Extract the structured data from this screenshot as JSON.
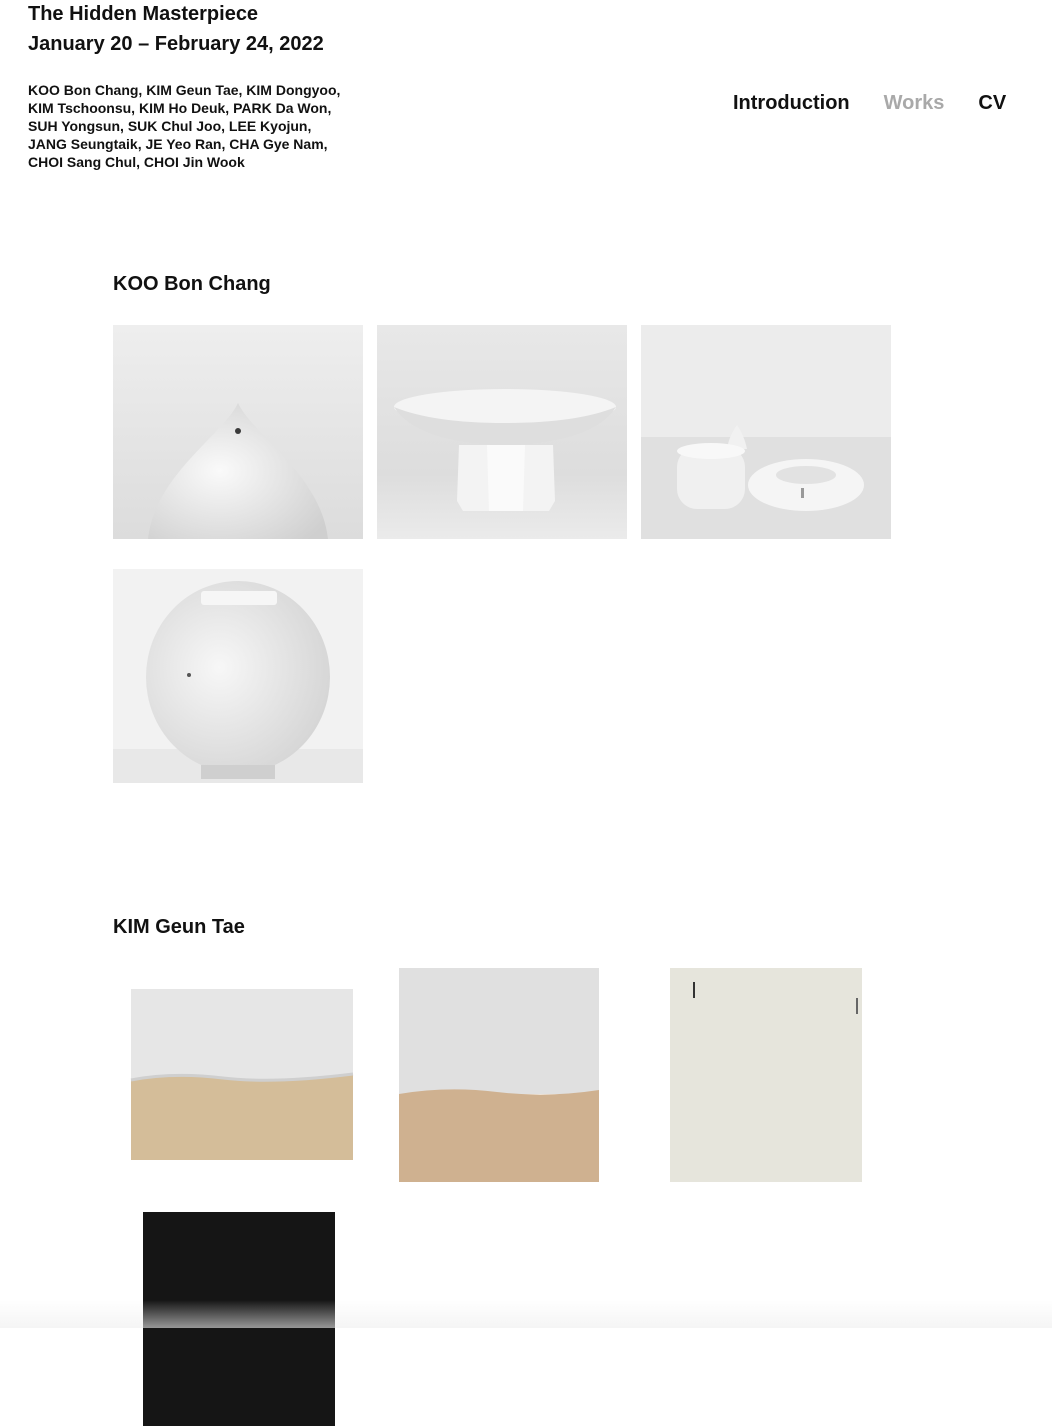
{
  "header": {
    "title": "The Hidden Masterpiece",
    "dates": "January 20 – February 24, 2022",
    "artists": "KOO Bon Chang, KIM Geun Tae, KIM Dongyoo, KIM Tschoonsu, KIM Ho Deuk, PARK Da Won, SUH Yongsun, SUK Chul Joo, LEE Kyojun, JANG Seungtaik, JE Yeo Ran, CHA Gye Nam, CHOI Sang Chul, CHOI Jin Wook"
  },
  "nav": {
    "items": [
      {
        "label": "Introduction",
        "active": false
      },
      {
        "label": "Works",
        "active": true
      },
      {
        "label": "CV",
        "active": false
      }
    ]
  },
  "sections": [
    {
      "artist": "KOO Bon Chang",
      "works": [
        {
          "subject": "white cone vessel"
        },
        {
          "subject": "white footed dish"
        },
        {
          "subject": "white ceramic objects"
        },
        {
          "subject": "white moon jar"
        }
      ]
    },
    {
      "artist": "KIM Geun Tae",
      "works": [
        {
          "subject": "white and ochre painting"
        },
        {
          "subject": "white and ochre painting"
        },
        {
          "subject": "off-white painting"
        },
        {
          "subject": "black painting"
        }
      ]
    }
  ],
  "colors": {
    "text": "#111111",
    "nav_active": "#a9a9a9",
    "background": "#ffffff"
  }
}
